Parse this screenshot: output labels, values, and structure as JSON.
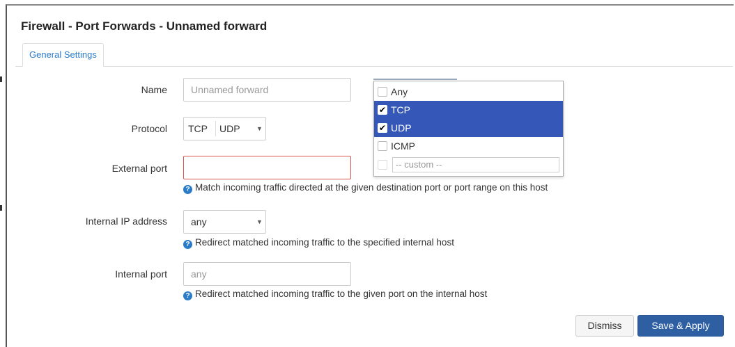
{
  "dialog": {
    "title": "Firewall - Port Forwards - Unnamed forward"
  },
  "tabs": [
    {
      "label": "General Settings",
      "active": true
    }
  ],
  "fields": {
    "name": {
      "label": "Name",
      "placeholder": "Unnamed forward",
      "value": ""
    },
    "protocol": {
      "label": "Protocol",
      "selected": [
        "TCP",
        "UDP"
      ],
      "options": [
        {
          "label": "Any",
          "checked": false
        },
        {
          "label": "TCP",
          "checked": true
        },
        {
          "label": "UDP",
          "checked": true
        },
        {
          "label": "ICMP",
          "checked": false
        }
      ],
      "custom_placeholder": "-- custom --"
    },
    "external_port": {
      "label": "External port",
      "value": "",
      "help": "Match incoming traffic directed at the given destination port or port range on this host",
      "invalid": true
    },
    "internal_ip": {
      "label": "Internal IP address",
      "value": "any",
      "help": "Redirect matched incoming traffic to the specified internal host"
    },
    "internal_port": {
      "label": "Internal port",
      "placeholder": "any",
      "help": "Redirect matched incoming traffic to the given port on the internal host"
    }
  },
  "buttons": {
    "dismiss": "Dismiss",
    "save_apply": "Save & Apply"
  },
  "colors": {
    "accent": "#2a7bc8",
    "primary_button": "#2e5fa3",
    "selected_option": "#3558b8",
    "error_border": "#d9534f"
  },
  "icons": {
    "help": "question-circle-icon",
    "caret": "caret-down-icon",
    "checkbox": "checkbox-icon"
  }
}
